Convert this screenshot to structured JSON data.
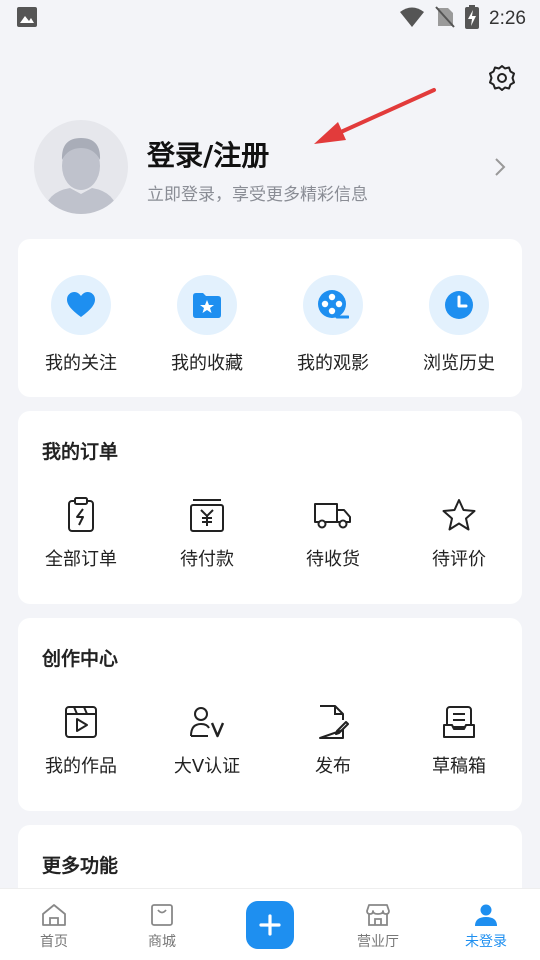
{
  "status_bar": {
    "time": "2:26"
  },
  "profile": {
    "title": "登录/注册",
    "subtitle": "立即登录，享受更多精彩信息"
  },
  "quick_links": [
    {
      "label": "我的关注",
      "icon": "heart-icon"
    },
    {
      "label": "我的收藏",
      "icon": "star-folder-icon"
    },
    {
      "label": "我的观影",
      "icon": "film-reel-icon"
    },
    {
      "label": "浏览历史",
      "icon": "clock-icon"
    }
  ],
  "orders": {
    "title": "我的订单",
    "items": [
      {
        "label": "全部订单",
        "icon": "clipboard-icon"
      },
      {
        "label": "待付款",
        "icon": "payment-icon"
      },
      {
        "label": "待收货",
        "icon": "truck-icon"
      },
      {
        "label": "待评价",
        "icon": "star-icon"
      }
    ]
  },
  "creator": {
    "title": "创作中心",
    "items": [
      {
        "label": "我的作品",
        "icon": "video-icon"
      },
      {
        "label": "大V认证",
        "icon": "user-v-icon"
      },
      {
        "label": "发布",
        "icon": "edit-doc-icon"
      },
      {
        "label": "草稿箱",
        "icon": "drafts-icon"
      }
    ]
  },
  "more": {
    "title": "更多功能"
  },
  "bottom_nav": [
    {
      "label": "首页",
      "icon": "home-icon"
    },
    {
      "label": "商城",
      "icon": "bag-icon"
    },
    {
      "label": "",
      "icon": "plus-icon"
    },
    {
      "label": "营业厅",
      "icon": "store-icon"
    },
    {
      "label": "未登录",
      "icon": "user-icon"
    }
  ],
  "colors": {
    "accent": "#1e8ff0",
    "icon_bg": "#e3f1fd",
    "annotation": "#e23b3b"
  }
}
